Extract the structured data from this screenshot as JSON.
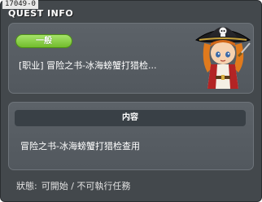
{
  "window": {
    "quest_id": "17049-0",
    "title": "QUEST INFO"
  },
  "quest": {
    "category_badge": "一般",
    "name": "[职业] 冒险之书-冰海螃蟹打猎检...",
    "avatar_icon": "pirate-npc-icon"
  },
  "content": {
    "header": "内容",
    "description": "冒险之书-冰海螃蟹打猎检查用"
  },
  "status": {
    "label": "狀態:",
    "value": "可開始 / 不可執行任務"
  },
  "colors": {
    "window_bg": "#43484c",
    "panel_bg": "#565c62",
    "badge_green": "#8ccf4a",
    "header_bg": "#394046"
  }
}
